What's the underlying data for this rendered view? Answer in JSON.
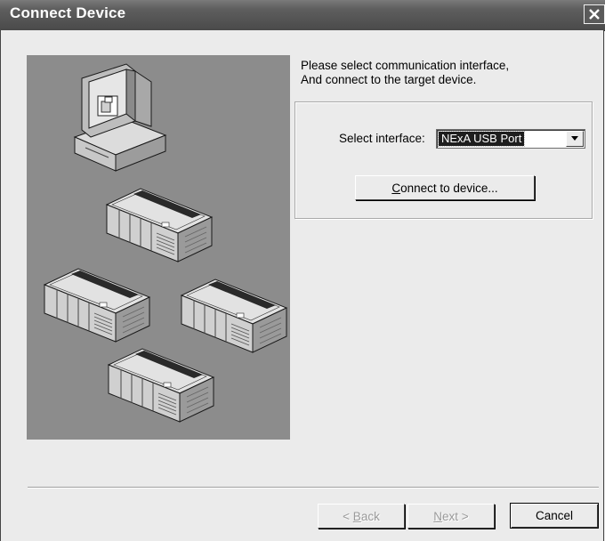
{
  "window": {
    "title": "Connect Device",
    "close_icon": "close-x-icon"
  },
  "illustration": {
    "icons": [
      "computer-monitor-icon",
      "plc-device-icon",
      "plc-device-icon",
      "plc-device-icon",
      "plc-device-icon"
    ]
  },
  "instructions": {
    "line1": "Please select communication interface,",
    "line2": "And connect to the target device."
  },
  "interface": {
    "label": "Select interface:",
    "selected": "NExA USB Port"
  },
  "connect_button": {
    "label_mnemonic": "C",
    "label_rest": "onnect to device..."
  },
  "footer": {
    "back": {
      "prefix": "< ",
      "mnemonic": "B",
      "rest": "ack"
    },
    "next": {
      "mnemonic": "N",
      "rest": "ext >"
    },
    "cancel": "Cancel"
  },
  "colors": {
    "titlebar": "#5a5a5a",
    "dialog_bg": "#ebebeb",
    "art_bg": "#8c8c8c",
    "disabled_text": "#9a9a9a"
  }
}
